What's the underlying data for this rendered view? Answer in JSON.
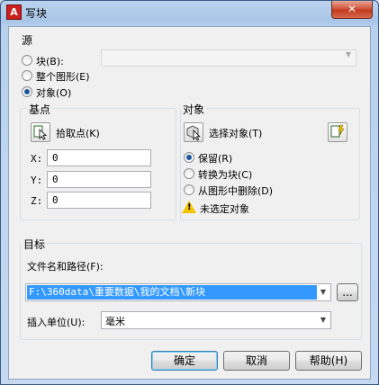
{
  "window": {
    "title": "写块",
    "close_label": "✕"
  },
  "source": {
    "label": "源",
    "options": [
      "块(B):",
      "整个图形(E)",
      "对象(O)"
    ],
    "selected": 2,
    "block_name": ""
  },
  "base_point": {
    "label": "基点",
    "pick_label": "拾取点(K)",
    "coords": [
      {
        "label": "X:",
        "value": "0"
      },
      {
        "label": "Y:",
        "value": "0"
      },
      {
        "label": "Z:",
        "value": "0"
      }
    ]
  },
  "objects": {
    "label": "对象",
    "select_label": "选择对象(T)",
    "options": [
      "保留(R)",
      "转换为块(C)",
      "从图形中删除(D)"
    ],
    "selected": 0,
    "warning": "未选定对象"
  },
  "target": {
    "label": "目标",
    "path_label": "文件名和路径(F):",
    "path_value": "F:\\360data\\重要数据\\我的文档\\新块",
    "browse_label": "...",
    "units_label": "插入单位(U):",
    "units_value": "毫米"
  },
  "buttons": {
    "ok": "确定",
    "cancel": "取消",
    "help": "帮助(H)"
  },
  "colors": {
    "selection": "#3399ff",
    "close": "#c23a1f",
    "warning": "#f5c400"
  }
}
